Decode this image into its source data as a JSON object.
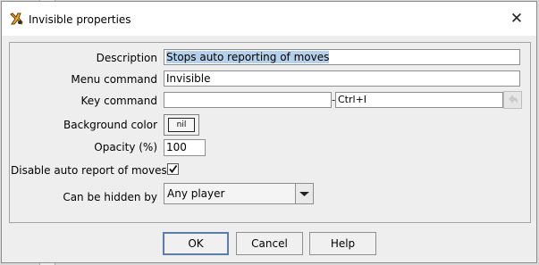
{
  "window": {
    "title": "Invisible properties"
  },
  "form": {
    "description_label": "Description",
    "description_value": "Stops auto reporting of moves",
    "menu_command_label": "Menu command",
    "menu_command_value": "Invisible",
    "key_command_label": "Key command",
    "key_command_value": "",
    "key_command_separator": "-",
    "key_command_display": "Ctrl+I",
    "background_color_label": "Background color",
    "background_color_value": "nil",
    "opacity_label": "Opacity (%)",
    "opacity_value": "100",
    "disable_auto_report_label": "Disable auto report of moves",
    "disable_auto_report_checked": true,
    "hidden_by_label": "Can be hidden by",
    "hidden_by_value": "Any player"
  },
  "buttons": {
    "ok": "OK",
    "cancel": "Cancel",
    "help": "Help"
  },
  "icons": {
    "app": "vassal-app-icon",
    "close": "close-icon",
    "undo": "undo-arrow-icon",
    "check": "checkmark-icon",
    "dropdown": "chevron-down-icon"
  }
}
